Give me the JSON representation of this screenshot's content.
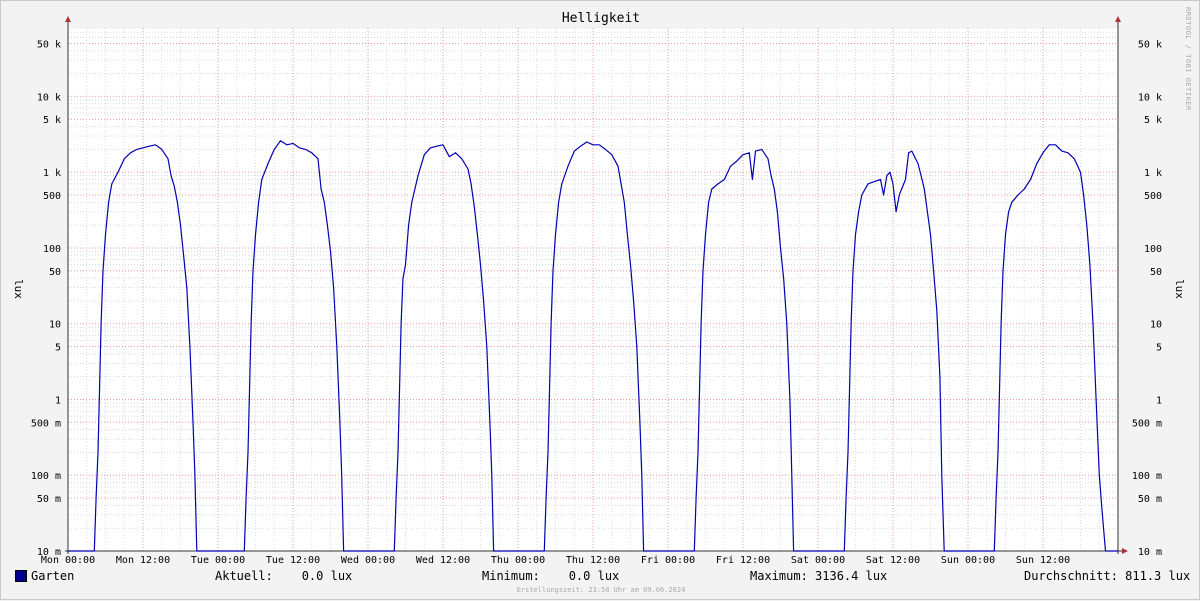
{
  "title": "Helligkeit",
  "watermark": "RRDTOOL / TOBI OETIKER",
  "footer": "Erstellungszeit: 23:58 Uhr am 09.06.2024",
  "chart_data": {
    "type": "line",
    "title": "Helligkeit",
    "ylabel": "lux",
    "y_scale": "log",
    "ylim": [
      10,
      80000
    ],
    "xlim_hours": [
      0,
      168
    ],
    "grid": true,
    "y_ticks": [
      {
        "value": 50000,
        "label": "50 k"
      },
      {
        "value": 10000,
        "label": "10 k"
      },
      {
        "value": 5000,
        "label": "5 k"
      },
      {
        "value": 1000,
        "label": "1 k"
      },
      {
        "value": 500,
        "label": "500"
      },
      {
        "value": 100,
        "label": "100"
      },
      {
        "value": 50,
        "label": "50"
      },
      {
        "value": 10,
        "label": "10"
      },
      {
        "value": 5,
        "label": "5"
      },
      {
        "value": 1,
        "label": "1"
      },
      {
        "value": 0.5,
        "label": "500 m"
      },
      {
        "value": 0.1,
        "label": "100 m"
      },
      {
        "value": 0.05,
        "label": "50 m"
      },
      {
        "value": 0.01,
        "label": "10 m"
      }
    ],
    "x_ticks": [
      {
        "hour": 0,
        "label": "Mon 00:00"
      },
      {
        "hour": 12,
        "label": "Mon 12:00"
      },
      {
        "hour": 24,
        "label": "Tue 00:00"
      },
      {
        "hour": 36,
        "label": "Tue 12:00"
      },
      {
        "hour": 48,
        "label": "Wed 00:00"
      },
      {
        "hour": 60,
        "label": "Wed 12:00"
      },
      {
        "hour": 72,
        "label": "Thu 00:00"
      },
      {
        "hour": 84,
        "label": "Thu 12:00"
      },
      {
        "hour": 96,
        "label": "Fri 00:00"
      },
      {
        "hour": 108,
        "label": "Fri 12:00"
      },
      {
        "hour": 120,
        "label": "Sat 00:00"
      },
      {
        "hour": 132,
        "label": "Sat 12:00"
      },
      {
        "hour": 144,
        "label": "Sun 00:00"
      },
      {
        "hour": 156,
        "label": "Sun 12:00"
      }
    ],
    "series": [
      {
        "name": "Garten",
        "color": "#0000b4",
        "points": [
          [
            0,
            0.01
          ],
          [
            4.2,
            0.01
          ],
          [
            4.5,
            0.05
          ],
          [
            4.8,
            0.2
          ],
          [
            5,
            1
          ],
          [
            5.3,
            10
          ],
          [
            5.6,
            50
          ],
          [
            6,
            150
          ],
          [
            6.5,
            400
          ],
          [
            7,
            700
          ],
          [
            8,
            1000
          ],
          [
            9,
            1500
          ],
          [
            10,
            1800
          ],
          [
            11,
            2000
          ],
          [
            12,
            2100
          ],
          [
            13,
            2200
          ],
          [
            14,
            2300
          ],
          [
            15,
            2000
          ],
          [
            16,
            1500
          ],
          [
            16.5,
            900
          ],
          [
            17,
            650
          ],
          [
            17.5,
            400
          ],
          [
            18,
            200
          ],
          [
            18.5,
            80
          ],
          [
            19,
            30
          ],
          [
            19.5,
            5
          ],
          [
            20,
            0.5
          ],
          [
            20.3,
            0.1
          ],
          [
            20.6,
            0.01
          ],
          [
            28.2,
            0.01
          ],
          [
            28.5,
            0.05
          ],
          [
            28.8,
            0.2
          ],
          [
            29,
            1
          ],
          [
            29.3,
            10
          ],
          [
            29.6,
            50
          ],
          [
            30,
            150
          ],
          [
            30.5,
            400
          ],
          [
            31,
            800
          ],
          [
            32,
            1300
          ],
          [
            33,
            2000
          ],
          [
            34,
            2600
          ],
          [
            35,
            2300
          ],
          [
            36,
            2400
          ],
          [
            37,
            2100
          ],
          [
            38,
            2000
          ],
          [
            39,
            1800
          ],
          [
            40,
            1500
          ],
          [
            40.5,
            600
          ],
          [
            41,
            400
          ],
          [
            41.5,
            200
          ],
          [
            42,
            90
          ],
          [
            42.5,
            30
          ],
          [
            43,
            5
          ],
          [
            43.5,
            0.5
          ],
          [
            43.8,
            0.1
          ],
          [
            44.1,
            0.01
          ],
          [
            52.2,
            0.01
          ],
          [
            52.5,
            0.05
          ],
          [
            52.8,
            0.2
          ],
          [
            53,
            1
          ],
          [
            53.3,
            10
          ],
          [
            53.6,
            40
          ],
          [
            54,
            60
          ],
          [
            54.5,
            200
          ],
          [
            55,
            400
          ],
          [
            56,
            900
          ],
          [
            57,
            1700
          ],
          [
            58,
            2100
          ],
          [
            59,
            2200
          ],
          [
            60,
            2300
          ],
          [
            61,
            1600
          ],
          [
            62,
            1800
          ],
          [
            63,
            1500
          ],
          [
            64,
            1100
          ],
          [
            64.5,
            700
          ],
          [
            65,
            350
          ],
          [
            65.5,
            150
          ],
          [
            66,
            60
          ],
          [
            66.5,
            20
          ],
          [
            67,
            5
          ],
          [
            67.5,
            0.5
          ],
          [
            67.8,
            0.1
          ],
          [
            68.1,
            0.01
          ],
          [
            76.2,
            0.01
          ],
          [
            76.5,
            0.05
          ],
          [
            76.8,
            0.2
          ],
          [
            77,
            1
          ],
          [
            77.3,
            10
          ],
          [
            77.6,
            50
          ],
          [
            78,
            150
          ],
          [
            78.5,
            400
          ],
          [
            79,
            700
          ],
          [
            80,
            1200
          ],
          [
            81,
            1900
          ],
          [
            82,
            2200
          ],
          [
            83,
            2500
          ],
          [
            84,
            2300
          ],
          [
            85,
            2300
          ],
          [
            86,
            2000
          ],
          [
            87,
            1700
          ],
          [
            88,
            1200
          ],
          [
            88.5,
            700
          ],
          [
            89,
            400
          ],
          [
            89.5,
            150
          ],
          [
            90,
            60
          ],
          [
            90.5,
            20
          ],
          [
            91,
            5
          ],
          [
            91.5,
            0.5
          ],
          [
            91.8,
            0.1
          ],
          [
            92.1,
            0.01
          ],
          [
            100.2,
            0.01
          ],
          [
            100.5,
            0.05
          ],
          [
            100.8,
            0.2
          ],
          [
            101,
            1
          ],
          [
            101.3,
            10
          ],
          [
            101.6,
            50
          ],
          [
            102,
            150
          ],
          [
            102.5,
            400
          ],
          [
            103,
            600
          ],
          [
            104,
            700
          ],
          [
            105,
            800
          ],
          [
            106,
            1200
          ],
          [
            107,
            1400
          ],
          [
            108,
            1700
          ],
          [
            109,
            1800
          ],
          [
            109.5,
            800
          ],
          [
            110,
            1900
          ],
          [
            111,
            2000
          ],
          [
            112,
            1500
          ],
          [
            112.5,
            900
          ],
          [
            113,
            600
          ],
          [
            113.5,
            300
          ],
          [
            114,
            100
          ],
          [
            114.5,
            40
          ],
          [
            115,
            10
          ],
          [
            115.5,
            1
          ],
          [
            115.8,
            0.1
          ],
          [
            116.1,
            0.01
          ],
          [
            124.2,
            0.01
          ],
          [
            124.5,
            0.05
          ],
          [
            124.8,
            0.2
          ],
          [
            125,
            1
          ],
          [
            125.3,
            10
          ],
          [
            125.6,
            50
          ],
          [
            126,
            150
          ],
          [
            126.5,
            300
          ],
          [
            127,
            500
          ],
          [
            128,
            700
          ],
          [
            129,
            750
          ],
          [
            130,
            800
          ],
          [
            130.5,
            500
          ],
          [
            131,
            900
          ],
          [
            131.5,
            1000
          ],
          [
            132,
            700
          ],
          [
            132.5,
            300
          ],
          [
            133,
            500
          ],
          [
            134,
            800
          ],
          [
            134.5,
            1800
          ],
          [
            135,
            1900
          ],
          [
            136,
            1300
          ],
          [
            136.5,
            900
          ],
          [
            137,
            600
          ],
          [
            137.5,
            300
          ],
          [
            138,
            150
          ],
          [
            138.5,
            50
          ],
          [
            139,
            15
          ],
          [
            139.5,
            2
          ],
          [
            139.8,
            0.1
          ],
          [
            140.2,
            0.01
          ],
          [
            148.2,
            0.01
          ],
          [
            148.5,
            0.05
          ],
          [
            148.8,
            0.2
          ],
          [
            149,
            1
          ],
          [
            149.3,
            10
          ],
          [
            149.6,
            50
          ],
          [
            150,
            150
          ],
          [
            150.5,
            300
          ],
          [
            151,
            400
          ],
          [
            152,
            500
          ],
          [
            153,
            600
          ],
          [
            154,
            800
          ],
          [
            155,
            1300
          ],
          [
            156,
            1800
          ],
          [
            157,
            2300
          ],
          [
            158,
            2300
          ],
          [
            159,
            1900
          ],
          [
            160,
            1800
          ],
          [
            161,
            1500
          ],
          [
            162,
            1000
          ],
          [
            162.5,
            500
          ],
          [
            163,
            200
          ],
          [
            163.5,
            60
          ],
          [
            164,
            10
          ],
          [
            164.5,
            1
          ],
          [
            165,
            0.1
          ],
          [
            165.5,
            0.03
          ],
          [
            166,
            0.01
          ],
          [
            168,
            0.01
          ]
        ]
      }
    ]
  },
  "legend": {
    "series_name": "Garten",
    "current": "Aktuell:    0.0 lux",
    "minimum": "Minimum:    0.0 lux",
    "maximum": "Maximum: 3136.4 lux",
    "average": "Durchschnitt: 811.3 lux"
  }
}
